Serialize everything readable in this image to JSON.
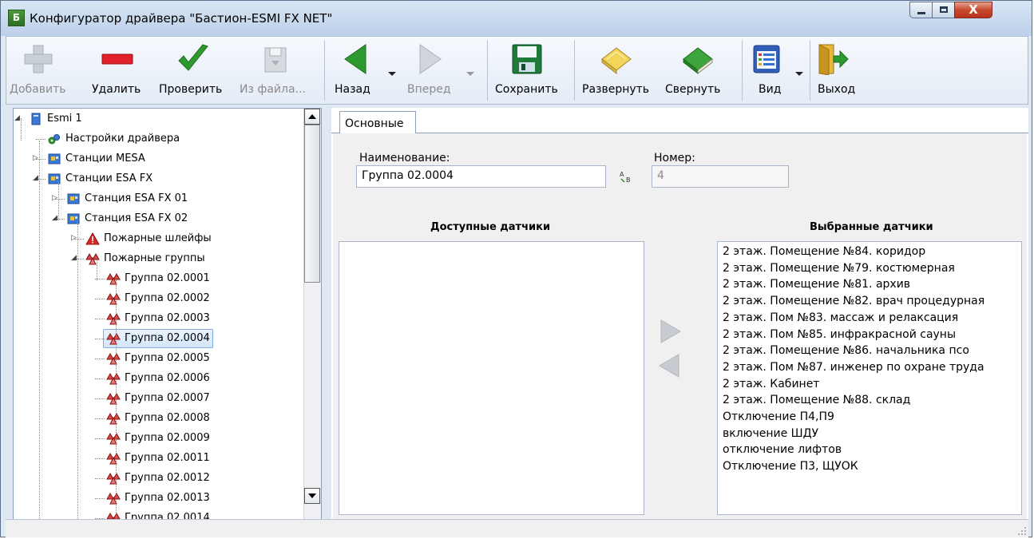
{
  "window": {
    "title": "Конфигуратор драйвера \"Бастион-ESMI FX NET\"",
    "app_icon": "bastion-app-icon",
    "app_icon_glyph": "Б"
  },
  "window_buttons": {
    "minimize": "minimize-icon",
    "maximize": "maximize-icon",
    "close": "X"
  },
  "toolbar": {
    "add": {
      "label": "Добавить",
      "icon": "plus-icon",
      "enabled": false
    },
    "delete": {
      "label": "Удалить",
      "icon": "minus-icon",
      "enabled": true
    },
    "check": {
      "label": "Проверить",
      "icon": "checkmark-icon",
      "enabled": true
    },
    "from_file": {
      "label": "Из файла...",
      "icon": "floppy-import-icon",
      "enabled": false
    },
    "back": {
      "label": "Назад",
      "icon": "back-arrow-icon",
      "enabled": true
    },
    "forward": {
      "label": "Вперед",
      "icon": "forward-arrow-icon",
      "enabled": false
    },
    "save": {
      "label": "Сохранить",
      "icon": "floppy-save-icon",
      "enabled": true
    },
    "expand": {
      "label": "Развернуть",
      "icon": "book-open-icon",
      "enabled": true
    },
    "collapse": {
      "label": "Свернуть",
      "icon": "book-closed-icon",
      "enabled": true
    },
    "view": {
      "label": "Вид",
      "icon": "view-window-icon",
      "enabled": true
    },
    "exit": {
      "label": "Выход",
      "icon": "exit-door-icon",
      "enabled": true
    }
  },
  "tree": {
    "items": [
      {
        "label": "Esmi 1",
        "icon": "server-icon"
      },
      {
        "label": "Настройки драйвера",
        "icon": "gears-icon"
      },
      {
        "label": "Станции MESA",
        "icon": "station-folder-icon"
      },
      {
        "label": "Станции ESA FX",
        "icon": "station-folder-icon"
      },
      {
        "label": "Станция ESA FX 01",
        "icon": "station-icon"
      },
      {
        "label": "Станция ESA FX 02",
        "icon": "station-icon"
      },
      {
        "label": "Пожарные шлейфы",
        "icon": "fire-warning-icon"
      },
      {
        "label": "Пожарные группы",
        "icon": "fire-group-icon"
      },
      {
        "label": "Группа 02.0001",
        "icon": "fire-group-icon"
      },
      {
        "label": "Группа 02.0002",
        "icon": "fire-group-icon"
      },
      {
        "label": "Группа 02.0003",
        "icon": "fire-group-icon"
      },
      {
        "label": "Группа 02.0004",
        "icon": "fire-group-icon",
        "selected": true
      },
      {
        "label": "Группа 02.0005",
        "icon": "fire-group-icon"
      },
      {
        "label": "Группа 02.0006",
        "icon": "fire-group-icon"
      },
      {
        "label": "Группа 02.0007",
        "icon": "fire-group-icon"
      },
      {
        "label": "Группа 02.0008",
        "icon": "fire-group-icon"
      },
      {
        "label": "Группа 02.0009",
        "icon": "fire-group-icon"
      },
      {
        "label": "Группа 02.0011",
        "icon": "fire-group-icon"
      },
      {
        "label": "Группа 02.0012",
        "icon": "fire-group-icon"
      },
      {
        "label": "Группа 02.0013",
        "icon": "fire-group-icon"
      },
      {
        "label": "Группа 02.0014",
        "icon": "fire-group-icon"
      }
    ]
  },
  "tabs": [
    {
      "label": "Основные",
      "active": true
    }
  ],
  "form": {
    "name_label": "Наименование:",
    "name_value": "Группа 02.0004",
    "number_label": "Номер:",
    "number_value": "4",
    "rename_icon": "auto-name-icon"
  },
  "available_title": "Доступные датчики",
  "selected_title": "Выбранные датчики",
  "available_sensors": [],
  "selected_sensors": [
    "2 этаж. Помещение №84. коридор",
    "2 этаж. Помещение №79. костюмерная",
    "2 этаж. Помещение №81. архив",
    "2 этаж. Помещение №82. врач процедурная",
    "2 этаж. Пом №83. массаж и релаксация",
    "2 этаж. Пом №85. инфракрасной сауны",
    "2 этаж. Помещение №86. начальника псо",
    "2 этаж. Пом №87. инженер по охране труда",
    "2 этаж. Кабинет",
    "2 этаж. Помещение №88. склад",
    "Отключение П4,П9",
    "включение ШДУ",
    "отключение лифтов",
    "Отключение П3, ЩУОК"
  ],
  "transfer": {
    "move_right": "move-right-icon",
    "move_left": "move-left-icon"
  },
  "colors": {
    "accent_green": "#2e9a2e",
    "selection": "#d3e6fa",
    "fire_red": "#c0392b"
  }
}
